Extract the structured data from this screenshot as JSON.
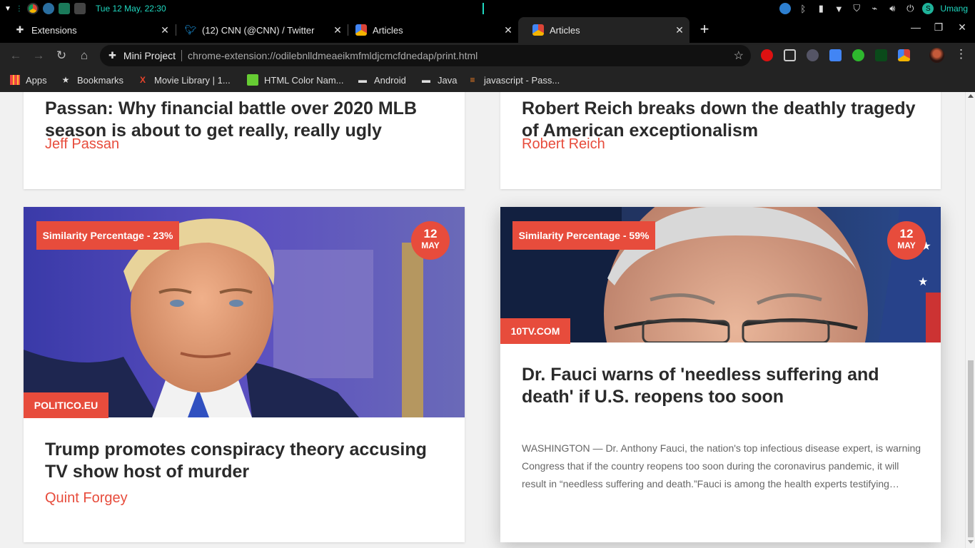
{
  "os": {
    "clock": "Tue 12 May, 22:30",
    "user": "Umang"
  },
  "tabs": [
    {
      "title": "Extensions",
      "icon": "puzzle-icon"
    },
    {
      "title": "(12) CNN (@CNN) / Twitter",
      "icon": "twitter-icon"
    },
    {
      "title": "Articles",
      "icon": "chrome-ext-icon"
    },
    {
      "title": "Articles",
      "icon": "chrome-ext-icon",
      "active": true
    }
  ],
  "omnibox": {
    "site": "Mini Project",
    "url": "chrome-extension://odilebnlldmeaeikmfmldjcmcfdnedap/print.html"
  },
  "bookmarks": [
    {
      "label": "Apps",
      "icon": "apps-grid-icon"
    },
    {
      "label": "Bookmarks",
      "icon": "star-icon"
    },
    {
      "label": "Movie Library | 1...",
      "icon": "x-logo-icon"
    },
    {
      "label": "HTML Color Nam...",
      "icon": "color-icon"
    },
    {
      "label": "Android",
      "icon": "folder-icon"
    },
    {
      "label": "Java",
      "icon": "folder-icon"
    },
    {
      "label": "javascript - Pass...",
      "icon": "stackoverflow-icon"
    }
  ],
  "articles": [
    {
      "title": "Passan: Why financial battle over 2020 MLB season is about to get really, really ugly",
      "title_visible": "Passan: Why financial battle over 2020 MLB season is about to get really, really ugly",
      "author": "Jeff Passan"
    },
    {
      "title": "Robert Reich breaks down the deathly tragedy of American exceptionalism",
      "author": "Robert Reich"
    },
    {
      "similarity": "Similarity Percentage - 23%",
      "date_day": "12",
      "date_month": "MAY",
      "source": "POLITICO.EU",
      "title": "Trump promotes conspiracy theory accusing TV show host of murder",
      "author": "Quint Forgey"
    },
    {
      "similarity": "Similarity Percentage - 59%",
      "date_day": "12",
      "date_month": "MAY",
      "source": "10TV.COM",
      "title": "Dr. Fauci warns of 'needless suffering and death' if U.S. reopens too soon",
      "description": "WASHINGTON — Dr. Anthony Fauci, the nation's top infectious disease expert, is warning Congress that if the country reopens too soon during the coronavirus pandemic, it will result in “needless suffering and death.”Fauci is among the health experts testifying…"
    }
  ],
  "colors": {
    "accent": "#e74c3c",
    "teal": "#1fd8c0"
  }
}
